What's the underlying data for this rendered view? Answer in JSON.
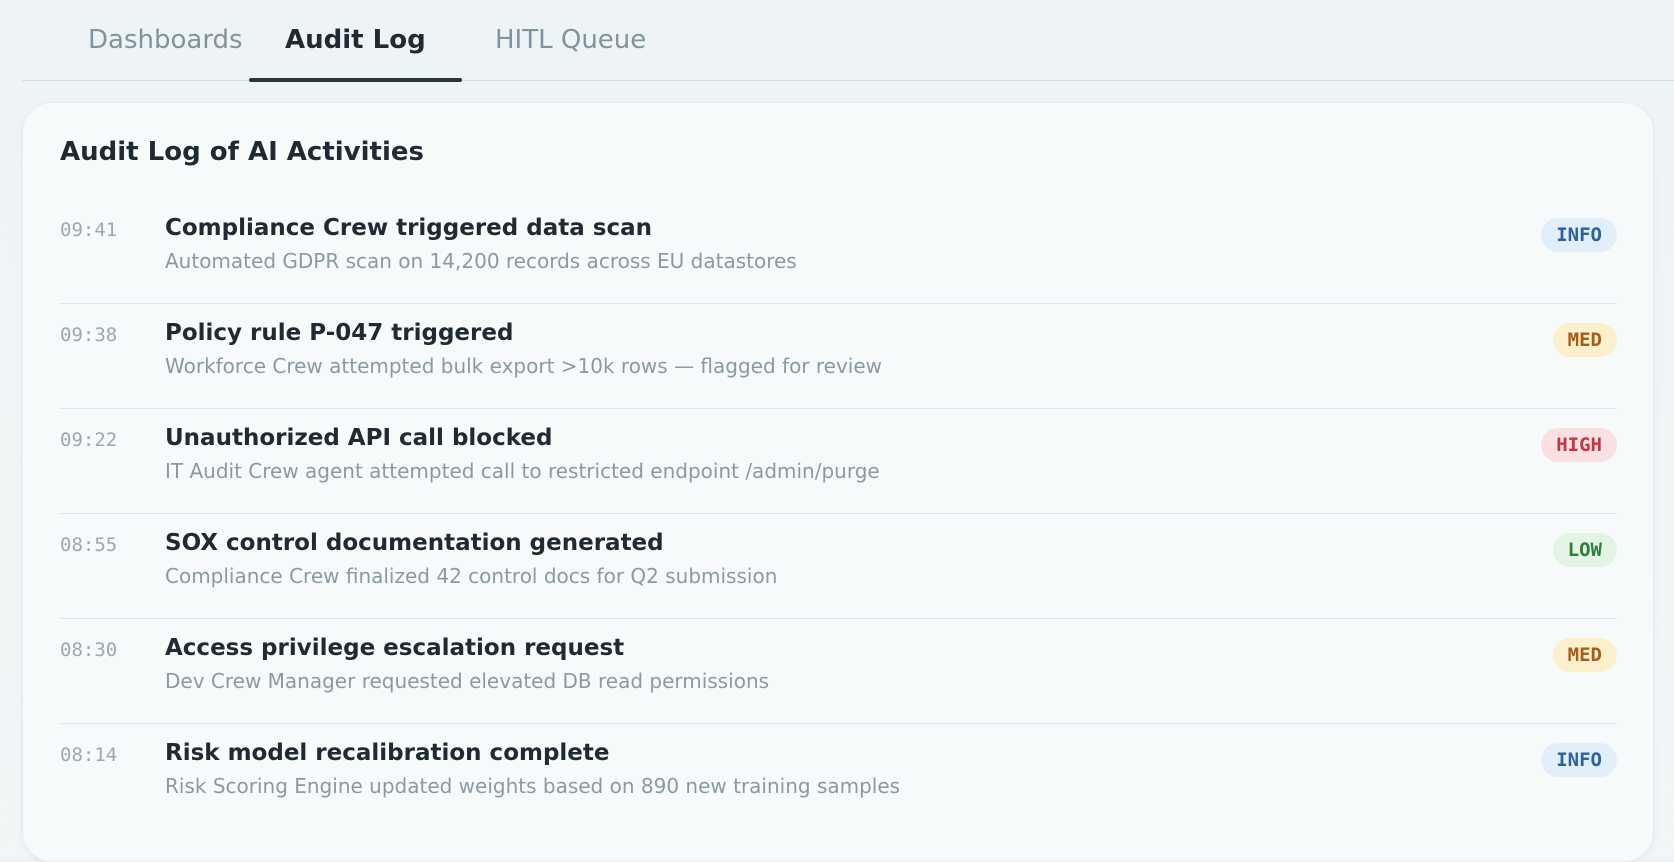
{
  "tabs": [
    {
      "label": "Dashboards",
      "active": false
    },
    {
      "label": "Audit Log",
      "active": true
    },
    {
      "label": "HITL Queue",
      "active": false
    }
  ],
  "card": {
    "title": "Audit Log of AI Activities"
  },
  "colors": {
    "info": "#2a62a0",
    "med": "#a45e1c",
    "high": "#c33743",
    "low": "#2e7f3c",
    "active_tab_underline": "#26353f"
  },
  "entries": [
    {
      "time": "09:41",
      "title": "Compliance Crew triggered data scan",
      "description": "Automated GDPR scan on 14,200 records across EU datastores",
      "severity": "INFO"
    },
    {
      "time": "09:38",
      "title": "Policy rule P-047 triggered",
      "description": "Workforce Crew attempted bulk export >10k rows — flagged for review",
      "severity": "MED"
    },
    {
      "time": "09:22",
      "title": "Unauthorized API call blocked",
      "description": "IT Audit Crew agent attempted call to restricted endpoint /admin/purge",
      "severity": "HIGH"
    },
    {
      "time": "08:55",
      "title": "SOX control documentation generated",
      "description": "Compliance Crew finalized 42 control docs for Q2 submission",
      "severity": "LOW"
    },
    {
      "time": "08:30",
      "title": "Access privilege escalation request",
      "description": "Dev Crew Manager requested elevated DB read permissions",
      "severity": "MED"
    },
    {
      "time": "08:14",
      "title": "Risk model recalibration complete",
      "description": "Risk Scoring Engine updated weights based on 890 new training samples",
      "severity": "INFO"
    }
  ]
}
